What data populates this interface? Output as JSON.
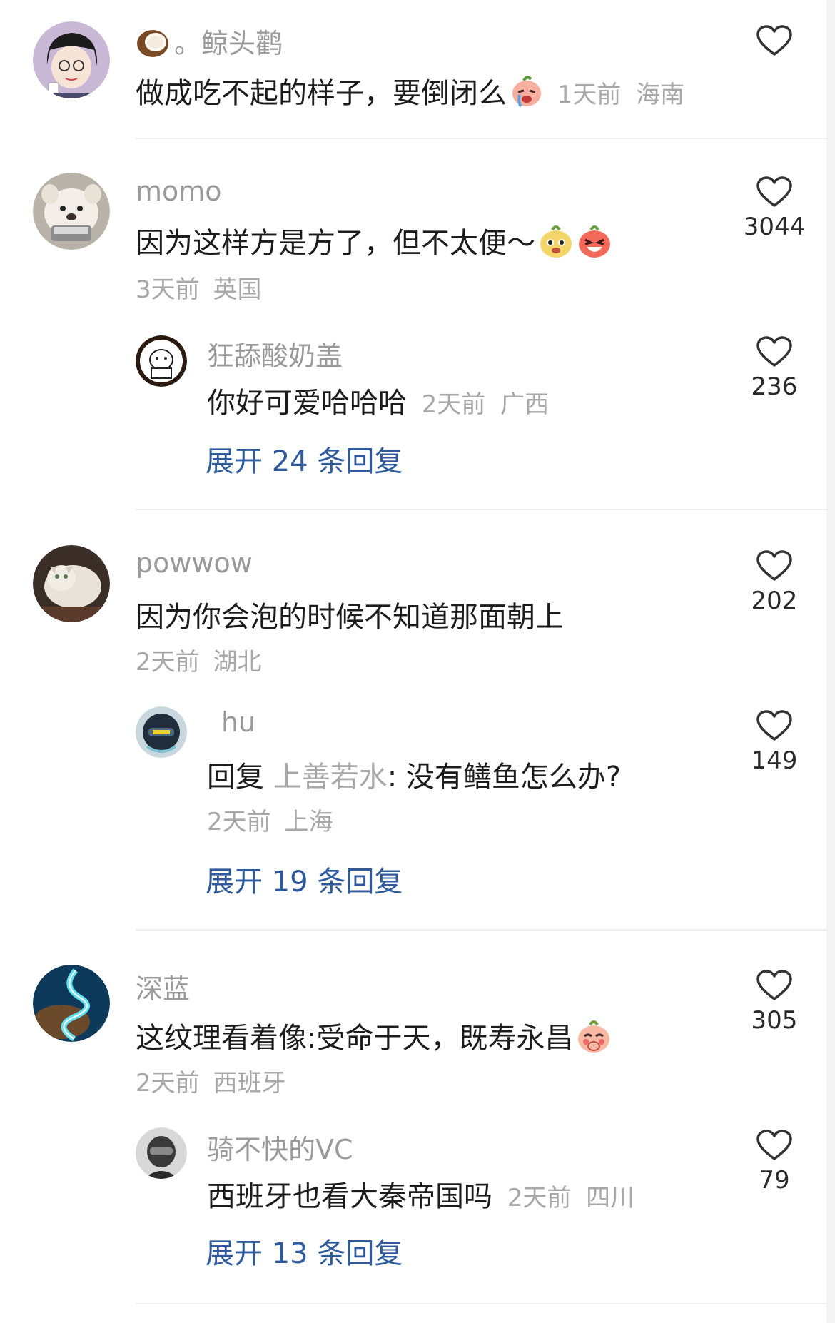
{
  "comments": [
    {
      "username": "。鲸头鹳",
      "text": "做成吃不起的样子，要倒闭么",
      "time": "1天前",
      "location": "海南",
      "likes": "",
      "avatar_icon": "cartoon-girl-avatar"
    },
    {
      "username": "momo",
      "text": "因为这样方是方了，但不太便～",
      "time": "3天前",
      "location": "英国",
      "likes": "3044",
      "avatar_icon": "dog-avatar",
      "replies": [
        {
          "username": "狂舔酸奶盖",
          "text": "你好可爱哈哈哈",
          "time": "2天前",
          "location": "广西",
          "likes": "236",
          "avatar_icon": "bear-doodle-avatar"
        }
      ],
      "expand_label": "展开 24 条回复"
    },
    {
      "username": "powwow",
      "text": "因为你会泡的时候不知道那面朝上",
      "time": "2天前",
      "location": "湖北",
      "likes": "202",
      "avatar_icon": "cat-avatar",
      "replies": [
        {
          "username": "hu",
          "reply_prefix": "回复",
          "reply_target": "上善若水",
          "text": ": 没有鳝鱼怎么办?",
          "time": "2天前",
          "location": "上海",
          "likes": "149",
          "avatar_icon": "helmet-avatar"
        }
      ],
      "expand_label": "展开 19 条回复"
    },
    {
      "username": "深蓝",
      "text": "这纹理看着像:受命于天，既寿永昌",
      "time": "2天前",
      "location": "西班牙",
      "likes": "305",
      "avatar_icon": "blue-river-avatar",
      "replies": [
        {
          "username": "骑不快的VC",
          "text": "西班牙也看大秦帝国吗",
          "time": "2天前",
          "location": "四川",
          "likes": "79",
          "avatar_icon": "pilot-avatar"
        }
      ],
      "expand_label": "展开 13 条回复"
    }
  ],
  "icons": {
    "like": "heart-outline-icon",
    "coconut": "coconut-icon",
    "emoji_cry": "crying-emoji-icon",
    "emoji_dog": "dog-face-emoji-icon",
    "emoji_laugh": "laughing-emoji-icon",
    "emoji_shy": "shy-emoji-icon"
  },
  "colors": {
    "link": "#2f5b9c",
    "meta": "#a8a8a8",
    "username": "#9a9a9a",
    "text": "#1c1c1c"
  }
}
